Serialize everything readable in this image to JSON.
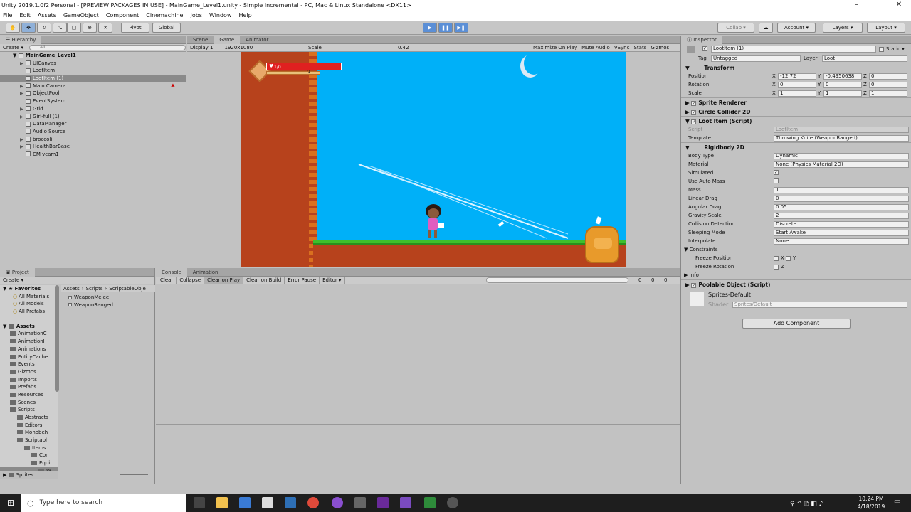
{
  "window": {
    "title": "Unity 2019.1.0f2 Personal - [PREVIEW PACKAGES IN USE] - MainGame_Level1.unity - Simple Incremental - PC, Mac & Linux Standalone <DX11>"
  },
  "menu": [
    "File",
    "Edit",
    "Assets",
    "GameObject",
    "Component",
    "Cinemachine",
    "Jobs",
    "Window",
    "Help"
  ],
  "toolbar": {
    "pivot": "Pivot",
    "global": "Global",
    "collab": "Collab ▾",
    "account": "Account",
    "layers": "Layers",
    "layout": "Layout"
  },
  "hierarchy": {
    "tab": "Hierarchy",
    "create": "Create ▾",
    "search": "All",
    "scene": "MainGame_Level1",
    "items": [
      {
        "label": "UICanvas",
        "arrow": "▶"
      },
      {
        "label": "LootItem",
        "arrow": ""
      },
      {
        "label": "LootItem (1)",
        "arrow": ""
      },
      {
        "label": "Main Camera",
        "arrow": "▶"
      },
      {
        "label": "ObjectPool",
        "arrow": "▶"
      },
      {
        "label": "EventSystem",
        "arrow": ""
      },
      {
        "label": "Grid",
        "arrow": "▶"
      },
      {
        "label": "Girl-full (1)",
        "arrow": "▶"
      },
      {
        "label": "DataManager",
        "arrow": ""
      },
      {
        "label": "Audio Source",
        "arrow": ""
      },
      {
        "label": "broccoli",
        "arrow": "▶"
      },
      {
        "label": "HealthBarBase",
        "arrow": "▶"
      },
      {
        "label": "CM vcam1",
        "arrow": ""
      }
    ]
  },
  "game": {
    "tabs": [
      "Scene",
      "Game",
      "Animator"
    ],
    "display": "Display 1",
    "resolution": "1920x1080",
    "scale_label": "Scale",
    "scale_value": "0.42",
    "options": [
      "Maximize On Play",
      "Mute Audio",
      "VSync",
      "Stats",
      "Gizmos"
    ],
    "health_text": "1/0",
    "xp_text": "/1"
  },
  "project": {
    "tab": "Project",
    "create": "Create ▾",
    "favorites_label": "Favorites",
    "favorites": [
      "All Materials",
      "All Models",
      "All Prefabs"
    ],
    "assets_label": "Assets",
    "assets": [
      "AnimationC",
      "AnimationI",
      "Animations",
      "EntityCache",
      "Events",
      "Gizmos",
      "Imports",
      "Prefabs",
      "Resources",
      "Scenes",
      "Scripts",
      "Abstracts",
      "Editors",
      "Monobeh",
      "Scriptabl",
      "Items",
      "Con",
      "Equi",
      "W"
    ],
    "sprites": "Sprites",
    "breadcrumb": [
      "Assets",
      "Scripts",
      "ScriptableObje"
    ],
    "files": [
      "WeaponMelee",
      "WeaponRanged"
    ]
  },
  "console": {
    "tabs": [
      "Console",
      "Animation"
    ],
    "buttons": [
      "Clear",
      "Collapse",
      "Clear on Play",
      "Clear on Build",
      "Error Pause",
      "Editor ▾"
    ],
    "counts": [
      "0",
      "0",
      "0"
    ]
  },
  "inspector": {
    "tab": "Inspector",
    "object_name": "LootItem (1)",
    "static": "Static",
    "tag_label": "Tag",
    "tag": "Untagged",
    "layer_label": "Layer",
    "layer": "Loot",
    "transform": {
      "title": "Transform",
      "rows": [
        {
          "label": "Position",
          "x": "-12.72",
          "y": "-0.4950638",
          "z": "0"
        },
        {
          "label": "Rotation",
          "x": "0",
          "y": "0",
          "z": "0"
        },
        {
          "label": "Scale",
          "x": "1",
          "y": "1",
          "z": "1"
        }
      ]
    },
    "sprite_renderer": "Sprite Renderer",
    "circle_collider": "Circle Collider 2D",
    "loot_item": {
      "title": "Loot Item (Script)",
      "script_label": "Script",
      "script": "LootItem",
      "template_label": "Template",
      "template": "Throwing Knife (WeaponRanged)"
    },
    "rigidbody": {
      "title": "Rigidbody 2D",
      "rows": [
        {
          "label": "Body Type",
          "value": "Dynamic",
          "kind": "dropdown"
        },
        {
          "label": "Material",
          "value": "None (Physics Material 2D)",
          "kind": "field"
        },
        {
          "label": "Simulated",
          "value": "✓",
          "kind": "check"
        },
        {
          "label": "Use Auto Mass",
          "value": "",
          "kind": "check"
        },
        {
          "label": "Mass",
          "value": "1",
          "kind": "field"
        },
        {
          "label": "Linear Drag",
          "value": "0",
          "kind": "field"
        },
        {
          "label": "Angular Drag",
          "value": "0.05",
          "kind": "field"
        },
        {
          "label": "Gravity Scale",
          "value": "2",
          "kind": "field"
        },
        {
          "label": "Collision Detection",
          "value": "Discrete",
          "kind": "dropdown"
        },
        {
          "label": "Sleeping Mode",
          "value": "Start Awake",
          "kind": "dropdown"
        },
        {
          "label": "Interpolate",
          "value": "None",
          "kind": "dropdown"
        }
      ]
    },
    "constraints": "Constraints",
    "freeze_position": "Freeze Position",
    "freeze_rotation": "Freeze Rotation",
    "x": "X",
    "y": "Y",
    "z": "Z",
    "info": "Info",
    "poolable": "Poolable Object (Script)",
    "material_name": "Sprites-Default",
    "shader_label": "Shader",
    "shader": "Sprites/Default",
    "add_component": "Add Component"
  },
  "taskbar": {
    "search": "Type here to search",
    "time": "10:24 PM",
    "date": "4/18/2019"
  }
}
